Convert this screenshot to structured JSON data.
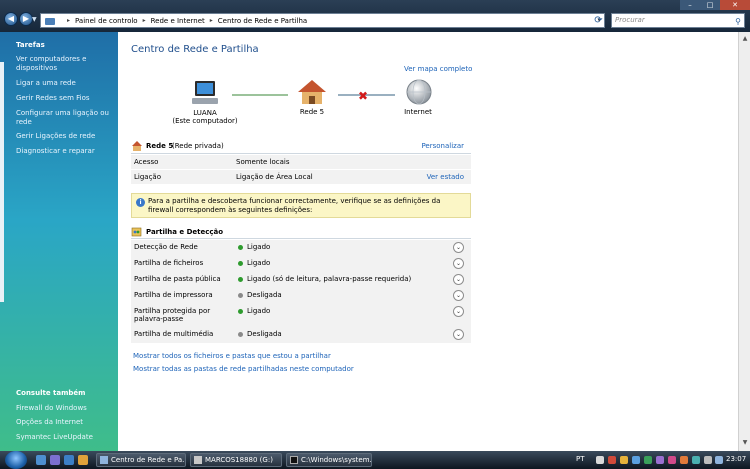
{
  "address_bar": {
    "crumbs": [
      "Painel de controlo",
      "Rede e Internet",
      "Centro de Rede e Partilha"
    ],
    "search_placeholder": "Procurar"
  },
  "sidebar": {
    "tasks_heading": "Tarefas",
    "tasks": [
      "Ver computadores e dispositivos",
      "Ligar a uma rede",
      "Gerir Redes sem Fios",
      "Configurar uma ligação ou rede",
      "Gerir Ligações de rede",
      "Diagnosticar e reparar"
    ],
    "see_also_heading": "Consulte também",
    "see_also": [
      "Firewall do Windows",
      "Opções da Internet",
      "Symantec LiveUpdate"
    ]
  },
  "main": {
    "title": "Centro de Rede e Partilha",
    "full_map_link": "Ver mapa completo",
    "map": {
      "computer_label": "LUANA",
      "computer_sub": "(Este computador)",
      "network_label": "Rede  5",
      "internet_label": "Internet",
      "internet_status": "disconnected"
    },
    "network": {
      "name": "Rede  5",
      "type": "(Rede privada)",
      "customize_link": "Personalizar",
      "rows": [
        {
          "key": "Acesso",
          "value": "Somente locais",
          "link": ""
        },
        {
          "key": "Ligação",
          "value": "Ligação de Área Local",
          "link": "Ver estado"
        }
      ]
    },
    "info_text": "Para a partilha e descoberta funcionar correctamente, verifique se as definições da firewall correspondem às seguintes definições:",
    "sharing": {
      "heading": "Partilha e Detecção",
      "rows": [
        {
          "key": "Detecção de Rede",
          "value": "Ligado",
          "status_color": "#2e9b2e"
        },
        {
          "key": "Partilha de ficheiros",
          "value": "Ligado",
          "status_color": "#2e9b2e"
        },
        {
          "key": "Partilha de pasta pública",
          "value": "Ligado (só de leitura, palavra-passe requerida)",
          "status_color": "#2e9b2e"
        },
        {
          "key": "Partilha de impressora",
          "value": "Desligada",
          "status_color": "#8a8a8a"
        },
        {
          "key": "Partilha protegida por palavra-passe",
          "value": "Ligado",
          "status_color": "#2e9b2e"
        },
        {
          "key": "Partilha de multimédia",
          "value": "Desligada",
          "status_color": "#8a8a8a"
        }
      ]
    },
    "bottom_links": [
      "Mostrar todos os ficheiros e pastas que estou a partilhar",
      "Mostrar todas as pastas de rede partilhadas neste computador"
    ]
  },
  "taskbar": {
    "buttons": [
      "Centro de Rede e Pa...",
      "MARCOS18880 (G:)",
      "C:\\Windows\\system..."
    ],
    "language": "PT",
    "clock": "23:07"
  }
}
